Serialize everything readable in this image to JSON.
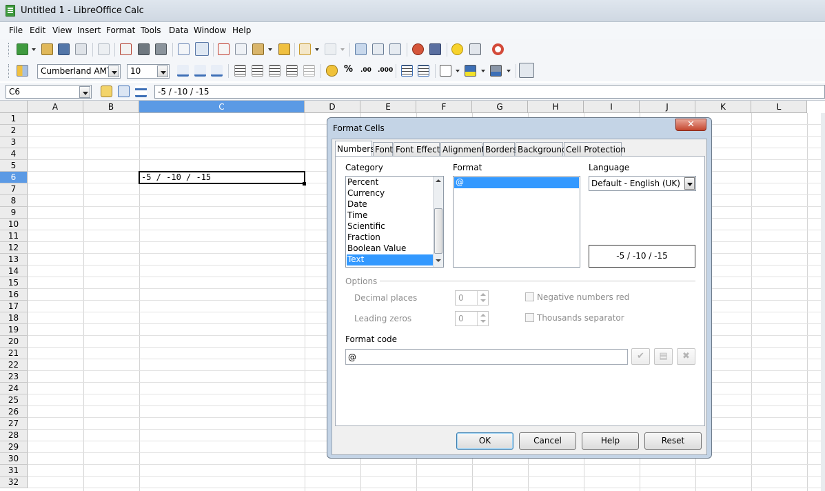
{
  "window": {
    "title": "Untitled 1 - LibreOffice Calc"
  },
  "menu": [
    "File",
    "Edit",
    "View",
    "Insert",
    "Format",
    "Tools",
    "Data",
    "Window",
    "Help"
  ],
  "toolbar": {
    "font_name": "Cumberland AMT;(",
    "font_size": "10",
    "percent_glyph": "%",
    "decimal_add_glyph": ".00",
    "decimal_del_glyph": ".000"
  },
  "formula_bar": {
    "cell_ref": "C6",
    "formula": "-5 / -10 / -15"
  },
  "sheet": {
    "columns": [
      "A",
      "B",
      "C",
      "D",
      "E",
      "F",
      "G",
      "H",
      "I",
      "J",
      "K",
      "L"
    ],
    "rows": [
      "1",
      "2",
      "3",
      "4",
      "5",
      "6",
      "7",
      "8",
      "9",
      "10",
      "11",
      "12",
      "13",
      "14",
      "15",
      "16",
      "17",
      "18",
      "19",
      "20",
      "21",
      "22",
      "23",
      "24",
      "25",
      "26",
      "27",
      "28",
      "29",
      "30",
      "31",
      "32"
    ],
    "selected_column": "C",
    "selected_row": "6",
    "c6_value": "-5 / -10 / -15"
  },
  "dialog": {
    "title": "Format Cells",
    "close_glyph": "✕",
    "tabs": [
      "Numbers",
      "Font",
      "Font Effects",
      "Alignment",
      "Borders",
      "Background",
      "Cell Protection"
    ],
    "category_label": "Category",
    "categories": [
      "Percent",
      "Currency",
      "Date",
      "Time",
      "Scientific",
      "Fraction",
      "Boolean Value",
      "Text"
    ],
    "selected_category": "Text",
    "format_label": "Format",
    "format_item": "@",
    "language_label": "Language",
    "language_value": "Default - English (UK)",
    "preview": "-5 / -10 / -15",
    "options_label": "Options",
    "decimal_places_label": "Decimal places",
    "decimal_places_value": "0",
    "leading_zeros_label": "Leading zeros",
    "leading_zeros_value": "0",
    "negative_red_label": "Negative numbers red",
    "thousands_label": "Thousands separator",
    "format_code_label": "Format code",
    "format_code_value": "@",
    "buttons": {
      "ok": "OK",
      "cancel": "Cancel",
      "help": "Help",
      "reset": "Reset"
    }
  }
}
